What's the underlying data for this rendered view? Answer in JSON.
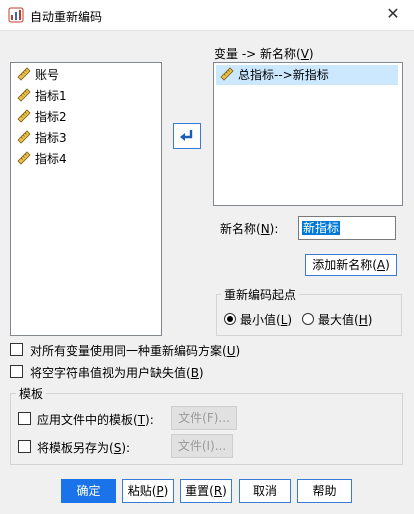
{
  "window": {
    "title": "自动重新编码",
    "close_glyph": "✕"
  },
  "source_variables": {
    "items": [
      "账号",
      "指标1",
      "指标2",
      "指标3",
      "指标4"
    ]
  },
  "mapping": {
    "label_pre": "变量 -> 新名称(",
    "label_key": "V",
    "label_post": ")",
    "items": [
      "总指标-->新指标"
    ]
  },
  "new_name": {
    "label_pre": "新名称(",
    "label_key": "N",
    "label_post": "):",
    "value": "新指标"
  },
  "add_new_name": {
    "pre": "添加新名称(",
    "key": "A",
    "post": ")"
  },
  "recode_start": {
    "title": "重新编码起点",
    "min": {
      "pre": "最小值(",
      "key": "L",
      "post": ")",
      "selected": true
    },
    "max": {
      "pre": "最大值(",
      "key": "H",
      "post": ")",
      "selected": false
    }
  },
  "options": {
    "same_scheme": {
      "pre": "对所有变量使用同一种重新编码方案(",
      "key": "U",
      "post": ")",
      "checked": false
    },
    "blank_missing": {
      "pre": "将空字符串值视为用户缺失值(",
      "key": "B",
      "post": ")",
      "checked": false
    }
  },
  "template": {
    "title": "模板",
    "apply": {
      "pre": "应用文件中的模板(",
      "key": "T",
      "post": "):",
      "file_btn": "文件(F)..."
    },
    "save": {
      "pre": "将模板另存为(",
      "key": "S",
      "post": "):",
      "file_btn": "文件(I)..."
    }
  },
  "buttons": {
    "ok": "确定",
    "paste": {
      "pre": "粘贴(",
      "key": "P",
      "post": ")"
    },
    "reset": {
      "pre": "重置(",
      "key": "R",
      "post": ")"
    },
    "cancel": "取消",
    "help": "帮助"
  },
  "colors": {
    "accent": "#1a73e8",
    "selection": "#cce8ff",
    "highlight": "#0078d7"
  }
}
